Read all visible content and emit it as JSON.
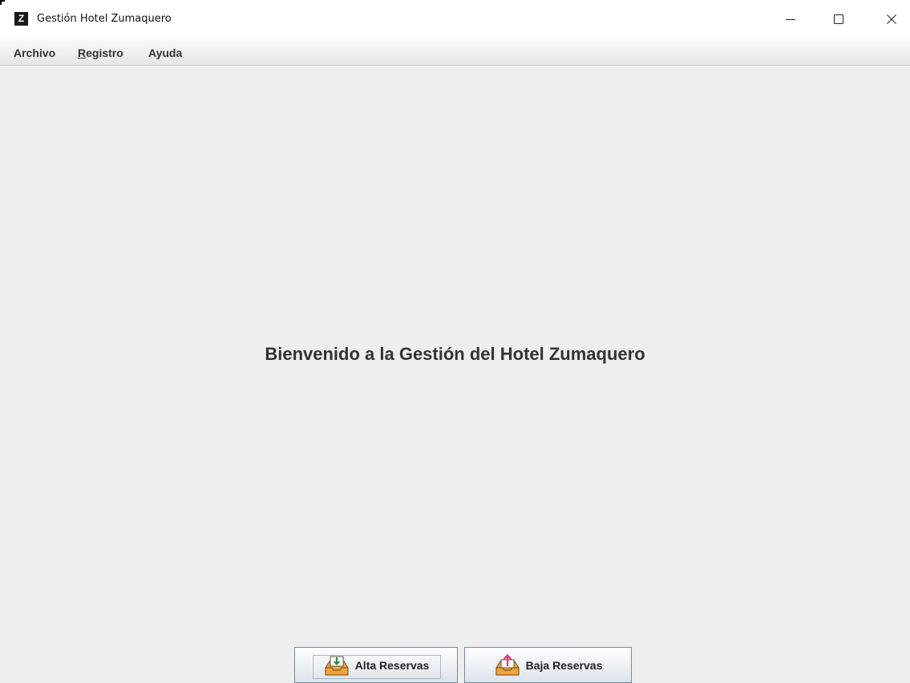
{
  "window": {
    "title": "Gestión Hotel Zumaquero",
    "app_icon_letter": "Z"
  },
  "menubar": {
    "items": [
      {
        "label": "Archivo"
      },
      {
        "mnemonic": "R",
        "rest": "egistro"
      },
      {
        "label": "Ayuda"
      }
    ]
  },
  "main": {
    "welcome_text": "Bienvenido a la Gestión del Hotel Zumaquero"
  },
  "buttons": {
    "alta": {
      "label": "Alta Reservas",
      "icon": "inbox-download-icon"
    },
    "baja": {
      "label": "Baja Reservas",
      "icon": "inbox-upload-icon"
    }
  },
  "colors": {
    "background": "#eeeeee",
    "text": "#333333",
    "upload_arrow": "#e0427a",
    "tray": "#f2a33a"
  }
}
